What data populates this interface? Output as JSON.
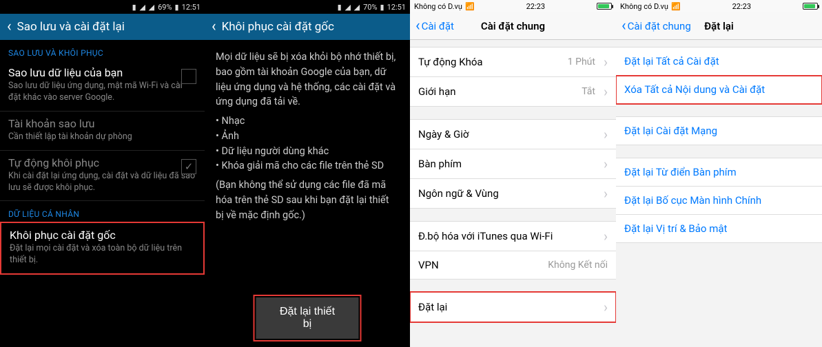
{
  "android1": {
    "statusbar": {
      "batt": "69%",
      "time": "12:51"
    },
    "title": "Sao lưu và cài đặt lại",
    "section_backup": "SAO LƯU VÀ KHÔI PHỤC",
    "backup_data": {
      "title": "Sao lưu dữ liệu của bạn",
      "sub": "Sao lưu dữ liệu ứng dụng, mật mã Wi-Fi và cài đặt khác vào server Google."
    },
    "account": {
      "title": "Tài khoản sao lưu",
      "sub": "Cần thiết lập tài khoản dự phòng"
    },
    "auto_restore": {
      "title": "Tự động khôi phục",
      "sub": "Khi cài đặt lại ứng dụng, cài đặt và dữ liệu đã sao lưu sẽ được khôi phục."
    },
    "section_personal": "DỮ LIỆU CÁ NHÂN",
    "factory_reset": {
      "title": "Khôi phục cài đặt gốc",
      "sub": "Đặt lại mọi cài đặt và xóa toàn bộ dữ liệu trên thiết bị."
    }
  },
  "android2": {
    "statusbar": {
      "batt": "70%",
      "time": "12:51"
    },
    "title": "Khôi phục cài đặt gốc",
    "intro": "Mọi dữ liệu sẽ bị xóa khỏi bộ nhớ thiết bị, bao gồm tài khoản Google của bạn, dữ liệu ứng dụng và hệ thống, các cài đặt và ứng dụng đã tải về.",
    "li1": "Nhạc",
    "li2": "Ảnh",
    "li3": "Dữ liệu người dùng khác",
    "li4": "Khóa giải mã cho các file trên thẻ SD",
    "note": "(Bạn không thể sử dụng các file đã mã hóa trên thẻ SD sau khi bạn đặt lại thiết bị về mặc định gốc.)",
    "button": "Đặt lại thiết bị"
  },
  "ios1": {
    "statusbar": {
      "carrier": "Không có D.vụ",
      "time": "22:23"
    },
    "back": "Cài đặt",
    "title": "Cài đặt chung",
    "rows": {
      "auto_lock": {
        "label": "Tự động Khóa",
        "value": "1 Phút"
      },
      "restrict": {
        "label": "Giới hạn",
        "value": "Tắt"
      },
      "date": {
        "label": "Ngày & Giờ"
      },
      "keyboard": {
        "label": "Bàn phím"
      },
      "lang": {
        "label": "Ngôn ngữ & Vùng"
      },
      "itunes": {
        "label": "Đ.bộ hóa với iTunes qua Wi-Fi"
      },
      "vpn": {
        "label": "VPN",
        "value": "Không Kết nối"
      },
      "reset": {
        "label": "Đặt lại"
      }
    }
  },
  "ios2": {
    "statusbar": {
      "carrier": "Không có D.vụ",
      "time": "22:23"
    },
    "back": "Cài đặt chung",
    "title": "Đặt lại",
    "rows": {
      "all_settings": "Đặt lại Tất cả Cài đặt",
      "erase_all": "Xóa Tất cả Nội dung và Cài đặt",
      "network": "Đặt lại Cài đặt Mạng",
      "keyboard_dict": "Đặt lại Từ điển Bàn phím",
      "home_layout": "Đặt lại Bố cục Màn hình Chính",
      "location": "Đặt lại Vị trí & Bảo mật"
    }
  }
}
